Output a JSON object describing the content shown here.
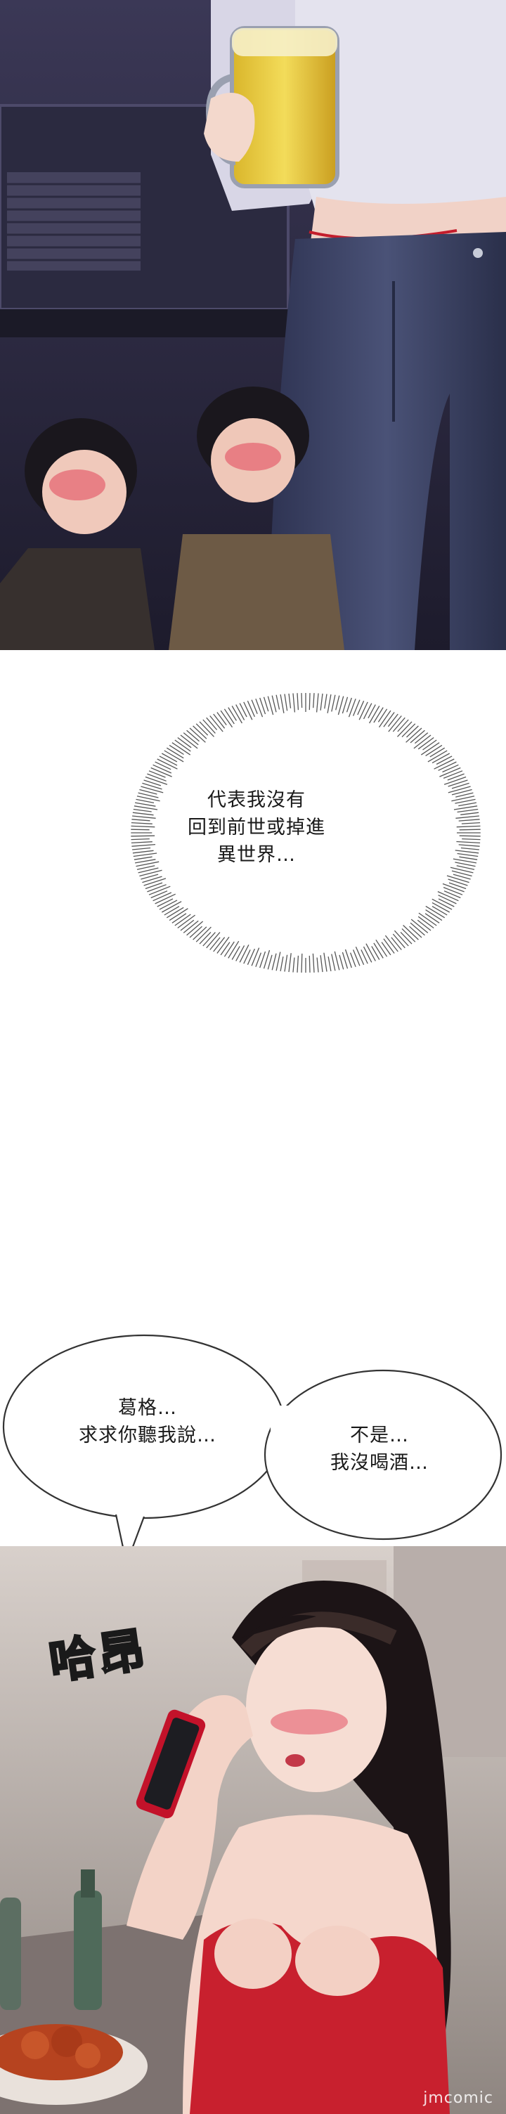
{
  "thought_bubble": {
    "lines": [
      "代表我沒有",
      "回到前世或掉進",
      "異世界…"
    ]
  },
  "speech_left": {
    "lines": [
      "葛格…",
      "求求你聽我說…"
    ]
  },
  "speech_right": {
    "lines": [
      "不是…",
      "我沒喝酒…"
    ]
  },
  "sound_effect": {
    "text": "哈昂"
  },
  "watermark": {
    "text": "jmcomic"
  },
  "colors": {
    "top_panel_bg": "#2c2a45",
    "beer": "#e8c83a",
    "jeans": "#3b4266",
    "blush": "#e2435a",
    "dress": "#c8202e",
    "hair": "#1c1416"
  }
}
